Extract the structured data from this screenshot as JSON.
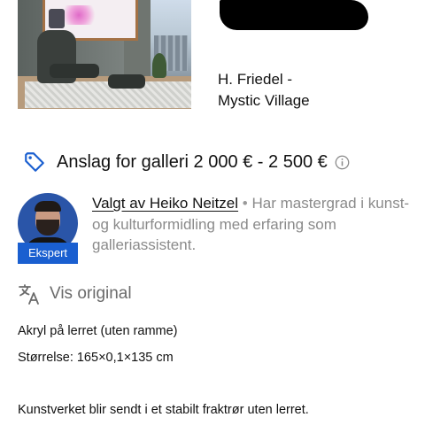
{
  "artwork": {
    "title_line1": "H. Friedel -",
    "title_line2": "Mystic Village",
    "image_icon": "artwork-room-photo"
  },
  "estimate": {
    "icon": "tag-icon",
    "text": "Anslag for galleri 2 000 € - 2 500 €",
    "info_icon": "info-icon",
    "accent_color": "#1a5fd0"
  },
  "expert": {
    "chosen_by": "Valgt av Heiko Neitzel",
    "separator": "•",
    "bio": "Har mastergrad i kunst- og kulturformidling med erfaring som galleriassistent.",
    "badge": "Ekspert",
    "badge_color": "#1a5fd0"
  },
  "translate": {
    "icon": "translate-icon",
    "label": "Vis original"
  },
  "description": {
    "line1": "Akryl på lerret (uten ramme)",
    "line2": "Størrelse: 165×0,1×135 cm",
    "line3": "Kunstverket blir sendt i et stabilt fraktrør uten lerret."
  }
}
